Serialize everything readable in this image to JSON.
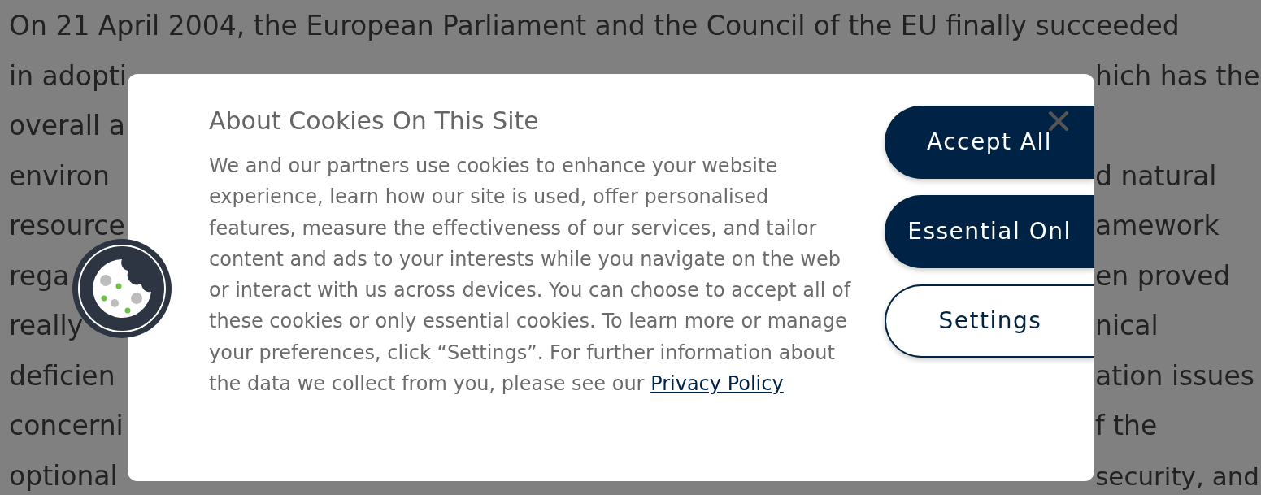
{
  "background_lines": [
    {
      "left": "On 21 April 2004, the European Parliament and the Council of the EU finally succeeded"
    },
    {
      "left": "in adopti",
      "right": "hich has the"
    },
    {
      "left": "overall a"
    },
    {
      "left": "environ",
      "right": "d natural"
    },
    {
      "left": "resource",
      "right": "amework"
    },
    {
      "left": "rega",
      "right": "en proved"
    },
    {
      "left": "really",
      "right": "nical"
    },
    {
      "left": "deficien",
      "right": "ation issues"
    },
    {
      "left": "concerni",
      "right": "f the"
    },
    {
      "left": "optional",
      "right": "security, and"
    }
  ],
  "dialog": {
    "title": "About Cookies On This Site",
    "body": "We and our partners use cookies to enhance your website experience, learn how our site is used, offer personalised features, measure the effectiveness of our services, and tailor content and ads to your interests while you navigate on the web or interact with us across devices. You can choose to accept all of these cookies or only essential cookies. To learn more or manage your preferences, click “Settings”. For further information about the data we collect from you, please see our",
    "link": "Privacy Policy",
    "buttons": [
      {
        "label": "Accept All",
        "kind": "filled"
      },
      {
        "label": "Essential Onl",
        "kind": "filled"
      },
      {
        "label": "Settings",
        "kind": "outline"
      }
    ]
  }
}
